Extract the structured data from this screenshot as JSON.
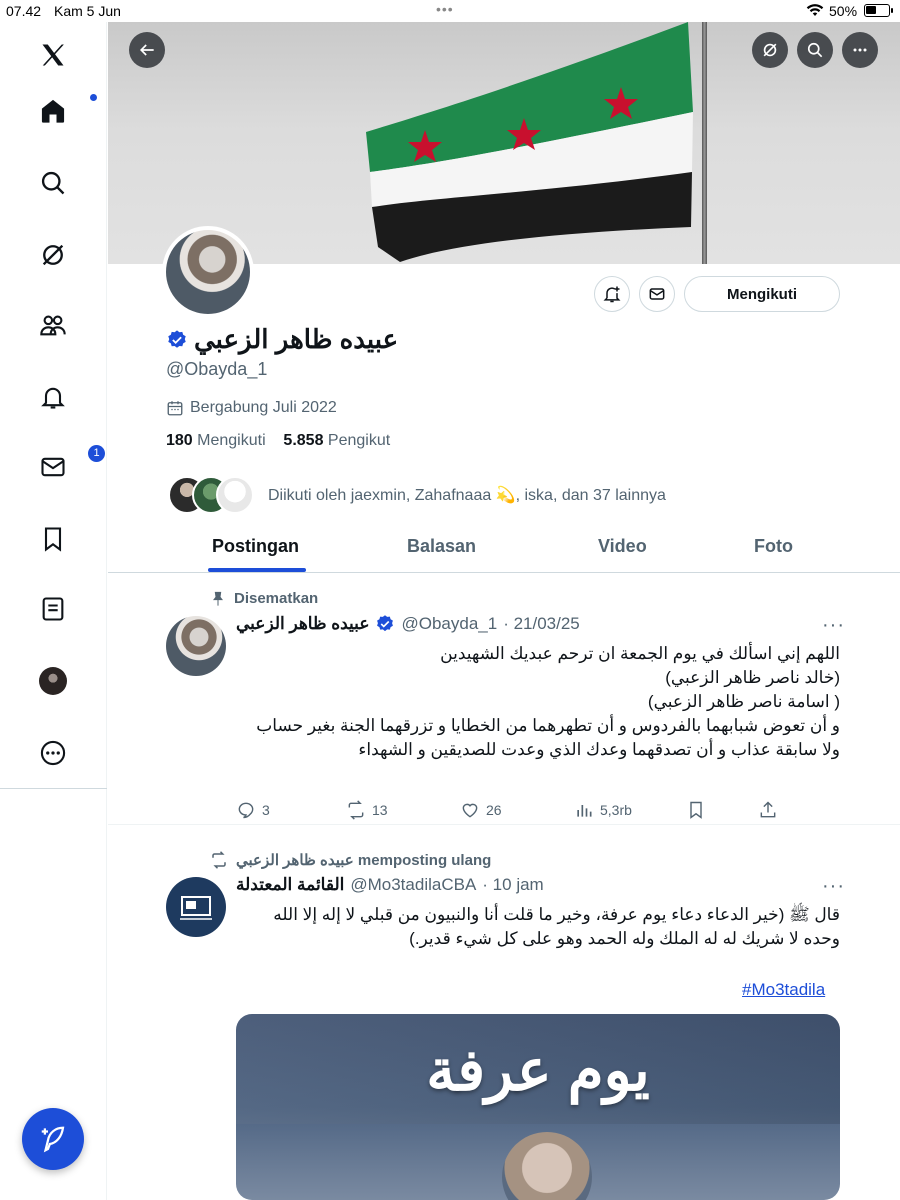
{
  "status": {
    "time": "07.42",
    "date": "Kam 5 Jun",
    "battery": "50%"
  },
  "sidebar": {
    "messages_badge": "1"
  },
  "profile": {
    "name": "عبيده ظاهر الزعبي",
    "handle": "@Obayda_1",
    "joined": "Bergabung Juli 2022",
    "following_count": "180",
    "following_label": "Mengikuti",
    "followers_count": "5.858",
    "followers_label": "Pengikut",
    "followed_by": "Diikuti oleh jaexmin, Zahafnaaa 💫, iska, dan 37 lainnya",
    "follow_button": "Mengikuti"
  },
  "tabs": [
    {
      "label": "Postingan"
    },
    {
      "label": "Balasan"
    },
    {
      "label": "Video"
    },
    {
      "label": "Foto"
    }
  ],
  "posts": [
    {
      "context": "Disematkan",
      "name": "عبيده ظاهر الزعبي",
      "handle": "@Obayda_1",
      "time": "· 21/03/25",
      "text": "اللهم إني اسألك في يوم الجمعة ان ترحم عبديك الشهيدين\n(خالد ناصر ظاهر الزعبي)\n( اسامة ناصر ظاهر الزعبي)\nو أن تعوض شبابهما بالفردوس و أن تطهرهما من الخطايا و تزرقهما الجنة بغير حساب\nولا سابقة عذاب و أن تصدقهما وعدك الذي وعدت للصديقين و الشهداء",
      "replies": "3",
      "reposts": "13",
      "likes": "26",
      "views": "5,3rb"
    },
    {
      "context": "عبيده ظاهر الزعبي memposting ulang",
      "name": "القائمة المعتدلة",
      "handle": "@Mo3tadilaCBA",
      "time": "· 10 jam",
      "text": "قال ﷺ (خير الدعاء دعاء يوم عرفة، وخير ما قلت أنا والنبيون من قبلي لا إله إلا الله\nوحده لا شريك له له الملك وله الحمد وهو على كل شيء قدير.)",
      "hashtag": "#Mo3tadila",
      "media_text": "يوم عرفة"
    }
  ],
  "colors": {
    "accent": "#1d4ed8",
    "muted": "#536471",
    "text": "#0f1419"
  }
}
